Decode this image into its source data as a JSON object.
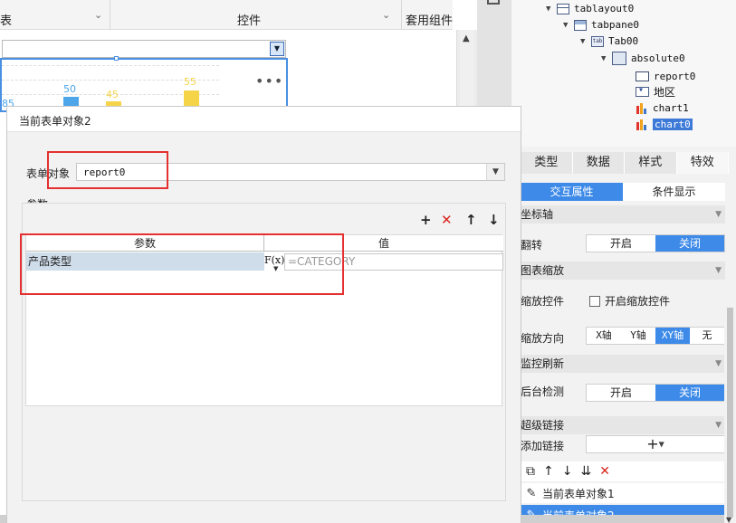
{
  "toolbar": {
    "left_label": "表",
    "middle_label": "控件",
    "right_label": "套用组件"
  },
  "canvas": {
    "bar_labels": [
      "85",
      "50",
      "45",
      "55"
    ],
    "colors": {
      "accent": "#3d8ae8",
      "blue_bar": "#4da6ea",
      "yellow_bar": "#f5d547"
    }
  },
  "tree": {
    "nodes": [
      {
        "name": "tablayout0",
        "icon": "tablayout-icon"
      },
      {
        "name": "tabpane0",
        "icon": "tabpane-icon"
      },
      {
        "name": "Tab00",
        "icon": "tab-icon"
      },
      {
        "name": "absolute0",
        "icon": "absolute-layout-icon"
      },
      {
        "name": "report0",
        "icon": "report-icon"
      },
      {
        "name": "地区",
        "icon": "combobox-icon"
      },
      {
        "name": "chart1",
        "icon": "chart-icon"
      },
      {
        "name": "chart0",
        "icon": "chart-icon",
        "selected": true
      }
    ]
  },
  "props": {
    "main_tabs": [
      "类型",
      "数据",
      "样式",
      "特效"
    ],
    "active_main_tab": "特效",
    "sub_tabs": [
      "交互属性",
      "条件显示"
    ],
    "active_sub_tab": "交互属性",
    "sections": {
      "axis": "坐标轴",
      "zoom": "图表缩放",
      "monitor": "监控刷新",
      "hyperlink": "超级链接"
    },
    "flip_label": "翻转",
    "flip_options": [
      "开启",
      "关闭"
    ],
    "flip_selected": "关闭",
    "zoom_control_label": "缩放控件",
    "zoom_control_checkbox": "开启缩放控件",
    "zoom_direction_label": "缩放方向",
    "zoom_direction_options": [
      "X轴",
      "Y轴",
      "XY轴",
      "无"
    ],
    "zoom_direction_selected": "XY轴",
    "backend_check_label": "后台检测",
    "backend_check_options": [
      "开启",
      "关闭"
    ],
    "backend_check_selected": "关闭",
    "add_link_label": "添加链接",
    "add_link_symbol": "+",
    "link_items": [
      "当前表单对象1",
      "当前表单对象2"
    ],
    "selected_link": "当前表单对象2"
  },
  "dialog": {
    "title": "当前表单对象2",
    "object_label": "表单对象",
    "object_value": "report0",
    "params_title": "参数",
    "table_headers": [
      "参数",
      "值"
    ],
    "rows": [
      {
        "name": "产品类型",
        "formula_icon": "F(x)",
        "value": "=CATEGORY"
      }
    ]
  }
}
